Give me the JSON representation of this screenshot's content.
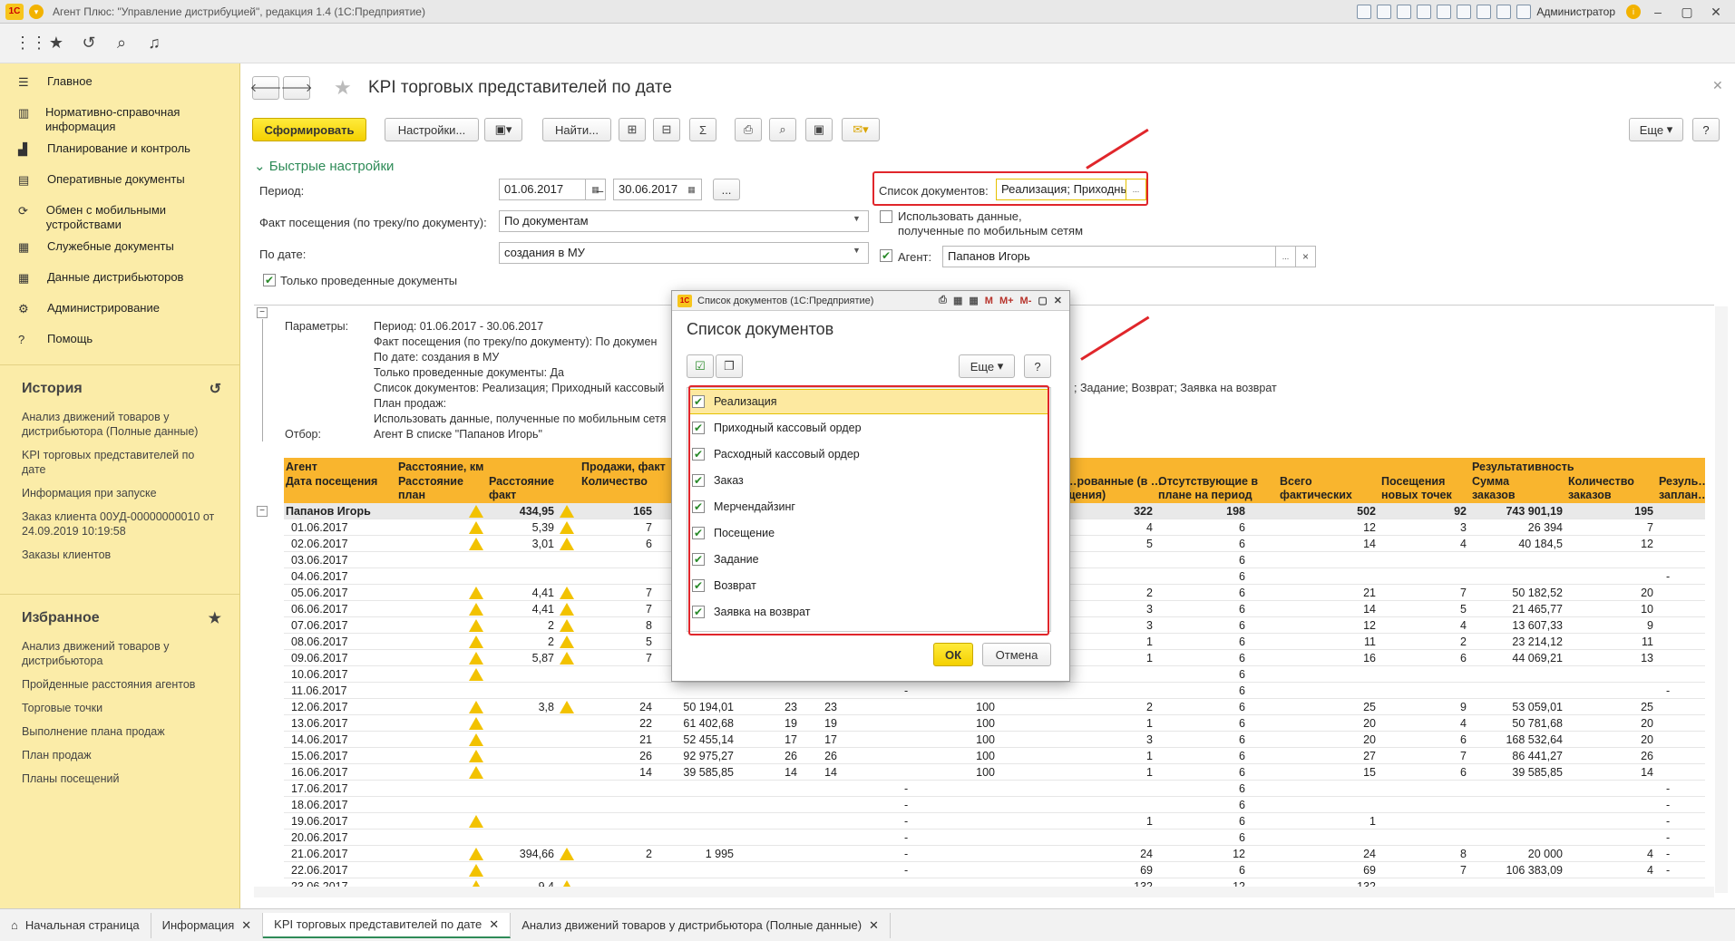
{
  "window": {
    "title": "Агент Плюс: \"Управление дистрибуцией\", редакция 1.4  (1С:Предприятие)",
    "user": "Администратор"
  },
  "sidebar": {
    "items": [
      {
        "label": "Главное",
        "icon": "menu-icon"
      },
      {
        "label": "Нормативно-справочная информация",
        "icon": "book-icon"
      },
      {
        "label": "Планирование и контроль",
        "icon": "chart-icon"
      },
      {
        "label": "Оперативные документы",
        "icon": "documents-icon"
      },
      {
        "label": "Обмен с мобильными устройствами",
        "icon": "sync-icon"
      },
      {
        "label": "Служебные документы",
        "icon": "table-icon"
      },
      {
        "label": "Данные дистрибьюторов",
        "icon": "grid-icon"
      },
      {
        "label": "Администрирование",
        "icon": "gear-icon"
      },
      {
        "label": "Помощь",
        "icon": "question-icon"
      }
    ],
    "history_title": "История",
    "history": [
      "Анализ движений товаров у дистрибьютора (Полные данные)",
      "KPI торговых представителей по дате",
      "Информация при запуске",
      "Заказ клиента 00УД-00000000010 от 24.09.2019 10:19:58",
      "Заказы клиентов"
    ],
    "favorites_title": "Избранное",
    "favorites": [
      "Анализ движений товаров у дистрибьютора",
      "Пройденные расстояния агентов",
      "Торговые точки",
      "Выполнение плана продаж",
      "План продаж",
      "Планы посещений"
    ]
  },
  "form": {
    "title": "KPI торговых представителей по дате",
    "generate": "Сформировать",
    "settings": "Настройки...",
    "find": "Найти...",
    "more": "Еще",
    "help": "?",
    "quick_settings": "Быстрые настройки",
    "period_label": "Период:",
    "date_from": "01.06.2017",
    "date_to": "30.06.2017",
    "dash": "–",
    "dots": "...",
    "visit_label": "Факт посещения (по треку/по документу):",
    "visit_value": "По документам",
    "bydate_label": "По дате:",
    "bydate_value": "создания в МУ",
    "posted_only": "Только проведенные документы",
    "doclist_label": "Список документов:",
    "doclist_value": "Реализация; Приходный кассовый",
    "mobile_data": "Использовать данные,",
    "mobile_data2": "полученные по мобильным сетям",
    "agent_label": "Агент:",
    "agent_value": "Папанов Игорь",
    "clear": "×"
  },
  "params": {
    "label": "Параметры:",
    "lines": [
      "Период: 01.06.2017 - 30.06.2017",
      "Факт посещения (по треку/по документу): По докумен",
      "По дате: создания в МУ",
      "Только проведенные документы: Да",
      "Список документов: Реализация; Приходный кассовый",
      "План продаж:",
      "Использовать данные, полученные по мобильным сетя"
    ],
    "tail": "; Задание; Возврат; Заявка на возврат",
    "filter_label": "Отбор:",
    "filter_value": "Агент В списке \"Папанов Игорь\""
  },
  "report": {
    "headers": {
      "agent": "Агент",
      "date": "Дата посещения",
      "dist": "Расстояние, км",
      "dist_plan": "Расстояние план",
      "dist_fact": "Расстояние факт",
      "sales": "Продажи, факт",
      "qty": "Количество",
      "visited": "…рованные (в …щения)",
      "absent": "Отсутствующие в плане на период",
      "total": "Всего фактических",
      "new": "Посещения новых точек",
      "result": "Результативность",
      "sum": "Сумма заказов",
      "count": "Количество заказов",
      "res2": "Резуль… заплан…"
    },
    "total": {
      "agent": "Папанов Игорь",
      "fact": "434,95",
      "qty": "165",
      "c_vis": "322",
      "c_abs": "198",
      "c_tot": "502",
      "c_new": "92",
      "c_sum": "743 901,19",
      "c_cnt": "195"
    },
    "rows": [
      {
        "d": "01.06.2017",
        "w1": true,
        "fact": "5,39",
        "w2": true,
        "q": "7",
        "vis": "4",
        "abs": "6",
        "tot": "12",
        "new": "3",
        "sum": "26 394",
        "cnt": "7"
      },
      {
        "d": "02.06.2017",
        "w1": true,
        "fact": "3,01",
        "w2": true,
        "q": "6",
        "vis": "5",
        "abs": "6",
        "tot": "14",
        "new": "4",
        "sum": "40 184,5",
        "cnt": "12"
      },
      {
        "d": "03.06.2017",
        "abs": "6"
      },
      {
        "d": "04.06.2017",
        "abs": "6",
        "r2": "-"
      },
      {
        "d": "05.06.2017",
        "w1": true,
        "fact": "4,41",
        "w2": true,
        "q": "7",
        "vis": "2",
        "abs": "6",
        "tot": "21",
        "new": "7",
        "sum": "50 182,52",
        "cnt": "20"
      },
      {
        "d": "06.06.2017",
        "w1": true,
        "fact": "4,41",
        "w2": true,
        "q": "7",
        "vis": "3",
        "abs": "6",
        "tot": "14",
        "new": "5",
        "sum": "21 465,77",
        "cnt": "10"
      },
      {
        "d": "07.06.2017",
        "w1": true,
        "fact": "2",
        "w2": true,
        "q": "8",
        "vis": "3",
        "abs": "6",
        "tot": "12",
        "new": "4",
        "sum": "13 607,33",
        "cnt": "9"
      },
      {
        "d": "08.06.2017",
        "w1": true,
        "fact": "2",
        "w2": true,
        "q": "5",
        "vis": "1",
        "abs": "6",
        "tot": "11",
        "new": "2",
        "sum": "23 214,12",
        "cnt": "11"
      },
      {
        "d": "09.06.2017",
        "w1": true,
        "fact": "5,87",
        "w2": true,
        "q": "7",
        "vis": "1",
        "abs": "6",
        "tot": "16",
        "new": "6",
        "sum": "44 069,21",
        "cnt": "13"
      },
      {
        "d": "10.06.2017",
        "w1": true,
        "abs": "6"
      },
      {
        "d": "11.06.2017",
        "abs": "6",
        "m1": "-",
        "r2": "-"
      },
      {
        "d": "12.06.2017",
        "w1": true,
        "fact": "3,8",
        "w2": true,
        "q": "24",
        "s": "50 194,01",
        "a": "23",
        "b": "23",
        "p": "100",
        "vis": "2",
        "abs": "6",
        "tot": "25",
        "new": "9",
        "sum": "53 059,01",
        "cnt": "25"
      },
      {
        "d": "13.06.2017",
        "w1": true,
        "q": "22",
        "s": "61 402,68",
        "a": "19",
        "b": "19",
        "p": "100",
        "vis": "1",
        "abs": "6",
        "tot": "20",
        "new": "4",
        "sum": "50 781,68",
        "cnt": "20"
      },
      {
        "d": "14.06.2017",
        "w1": true,
        "q": "21",
        "s": "52 455,14",
        "a": "17",
        "b": "17",
        "p": "100",
        "vis": "3",
        "abs": "6",
        "tot": "20",
        "new": "6",
        "sum": "168 532,64",
        "cnt": "20"
      },
      {
        "d": "15.06.2017",
        "w1": true,
        "q": "26",
        "s": "92 975,27",
        "a": "26",
        "b": "26",
        "p": "100",
        "vis": "1",
        "abs": "6",
        "tot": "27",
        "new": "7",
        "sum": "86 441,27",
        "cnt": "26"
      },
      {
        "d": "16.06.2017",
        "w1": true,
        "q": "14",
        "s": "39 585,85",
        "a": "14",
        "b": "14",
        "p": "100",
        "vis": "1",
        "abs": "6",
        "tot": "15",
        "new": "6",
        "sum": "39 585,85",
        "cnt": "14"
      },
      {
        "d": "17.06.2017",
        "m1": "-",
        "abs": "6",
        "r2": "-"
      },
      {
        "d": "18.06.2017",
        "m1": "-",
        "abs": "6",
        "r2": "-"
      },
      {
        "d": "19.06.2017",
        "w1": true,
        "m1": "-",
        "vis": "1",
        "abs": "6",
        "tot": "1",
        "r2": "-"
      },
      {
        "d": "20.06.2017",
        "m1": "-",
        "abs": "6",
        "r2": "-"
      },
      {
        "d": "21.06.2017",
        "w1": true,
        "fact": "394,66",
        "w2": true,
        "q": "2",
        "s": "1 995",
        "m1": "-",
        "vis": "24",
        "abs": "12",
        "tot": "24",
        "new": "8",
        "sum": "20 000",
        "cnt": "4",
        "r2": "-"
      },
      {
        "d": "22.06.2017",
        "w1": true,
        "m1": "-",
        "vis": "69",
        "abs": "6",
        "tot": "69",
        "new": "7",
        "sum": "106 383,09",
        "cnt": "4",
        "r2": "-"
      },
      {
        "d": "23.06.2017",
        "w1": true,
        "fact": "9,4",
        "w2": true,
        "m1": "-",
        "vis": "132",
        "abs": "12",
        "tot": "132",
        "r2": "-"
      }
    ]
  },
  "dialog": {
    "window_title": "Список документов  (1С:Предприятие)",
    "title": "Список документов",
    "more": "Еще",
    "help": "?",
    "ok": "ОК",
    "cancel": "Отмена",
    "mbtns": [
      "M",
      "M+",
      "M-"
    ],
    "items": [
      "Реализация",
      "Приходный кассовый ордер",
      "Расходный кассовый ордер",
      "Заказ",
      "Мерчендайзинг",
      "Посещение",
      "Задание",
      "Возврат",
      "Заявка на возврат"
    ]
  },
  "tabs": [
    "Начальная страница",
    "Информация",
    "KPI торговых представителей по дате",
    "Анализ движений товаров у дистрибьютора (Полные данные)"
  ],
  "colors": {
    "sidebar": "#fbeca8",
    "report_header": "#f9b52e",
    "accent_red": "#e0262b",
    "generate_button": "#f4d000"
  }
}
